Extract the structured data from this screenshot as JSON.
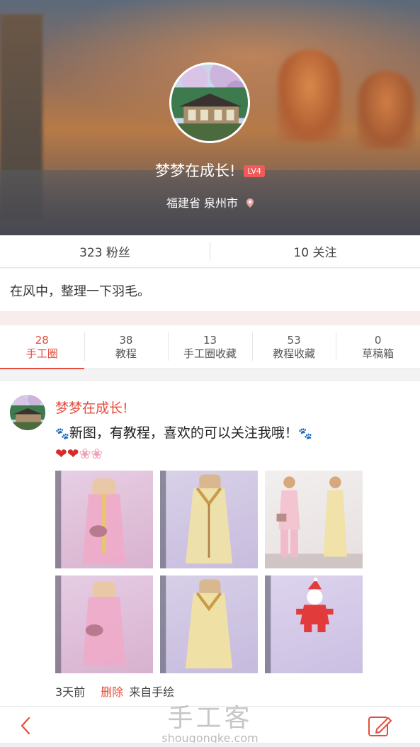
{
  "profile": {
    "name": "梦梦在成长!",
    "level": "LV4",
    "location": "福建省 泉州市"
  },
  "stats": {
    "fans": "323 粉丝",
    "following": "10 关注"
  },
  "bio": "在风中，整理一下羽毛。",
  "tabs": [
    {
      "count": "28",
      "label": "手工圈"
    },
    {
      "count": "38",
      "label": "教程"
    },
    {
      "count": "13",
      "label": "手工圈收藏"
    },
    {
      "count": "53",
      "label": "教程收藏"
    },
    {
      "count": "0",
      "label": "草稿箱"
    }
  ],
  "post": {
    "author": "梦梦在成长!",
    "text": "新图，有教程，喜欢的可以关注我哦！",
    "time": "3天前",
    "delete_label": "删除",
    "source": "来自手绘"
  },
  "watermark": {
    "main": "手工客",
    "sub": "shougongke.com"
  },
  "colors": {
    "accent": "#e74c3c"
  }
}
